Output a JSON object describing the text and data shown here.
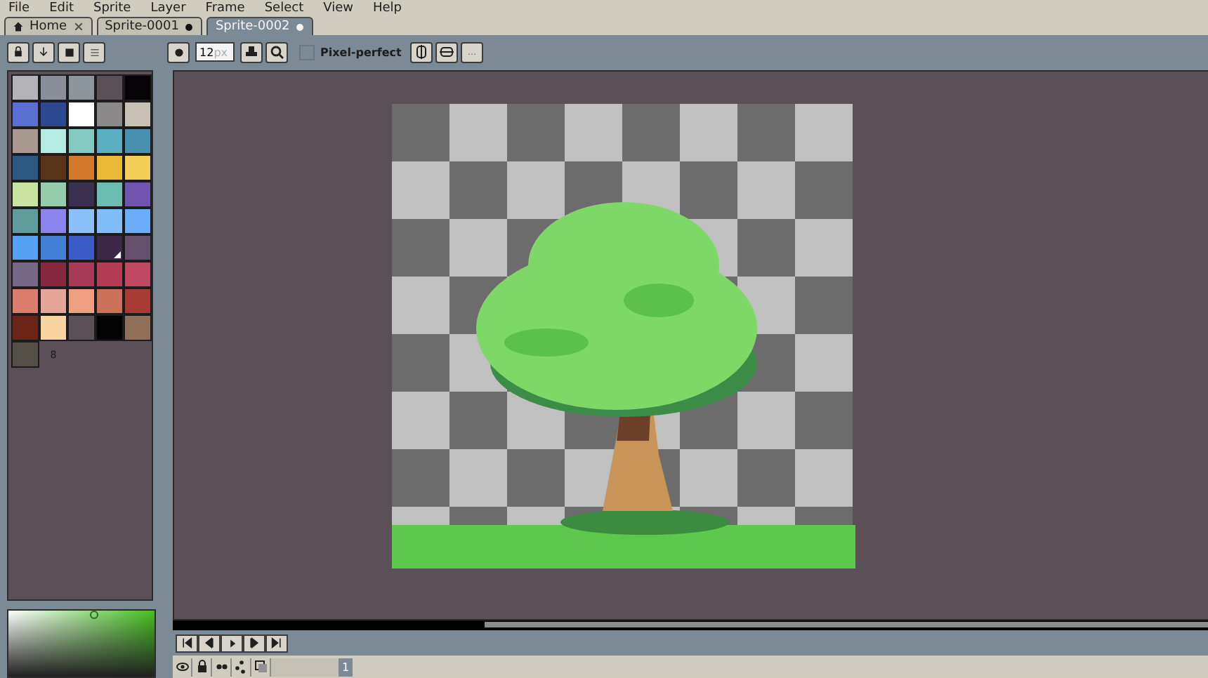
{
  "menu": [
    "File",
    "Edit",
    "Sprite",
    "Layer",
    "Frame",
    "Select",
    "View",
    "Help"
  ],
  "tabs": [
    {
      "label": "Home",
      "kind": "home",
      "selected": false
    },
    {
      "label": "Sprite-0001",
      "kind": "sprite",
      "selected": false
    },
    {
      "label": "Sprite-0002",
      "kind": "sprite",
      "selected": true
    }
  ],
  "toolbar": {
    "brush_size": "12",
    "brush_unit": "px",
    "pixel_perfect": {
      "label": "Pixel-perfect",
      "checked": false
    }
  },
  "palette": {
    "colors": [
      {
        "color": "#b4b4b8",
        "selected": false
      },
      {
        "color": "#8a8e98",
        "selected": false
      },
      {
        "color": "#8c949c",
        "selected": false
      },
      {
        "color": "#5c5058",
        "selected": false
      },
      {
        "color": "#060406",
        "selected": false
      },
      {
        "color": "#5a70d0",
        "selected": false
      },
      {
        "color": "#2c4890",
        "selected": false
      },
      {
        "color": "#ffffff",
        "selected": false
      },
      {
        "color": "#8a8888",
        "selected": false
      },
      {
        "color": "#c8c0b4",
        "selected": false
      },
      {
        "color": "#a89890",
        "selected": false
      },
      {
        "color": "#b4ece4",
        "selected": false
      },
      {
        "color": "#84cac0",
        "selected": false
      },
      {
        "color": "#5ab0c0",
        "selected": false
      },
      {
        "color": "#4a90b0",
        "selected": false
      },
      {
        "color": "#2c5884",
        "selected": false
      },
      {
        "color": "#5a3418",
        "selected": false
      },
      {
        "color": "#d4782c",
        "selected": false
      },
      {
        "color": "#ecb838",
        "selected": false
      },
      {
        "color": "#f4cc58",
        "selected": false
      },
      {
        "color": "#c8e4a0",
        "selected": false
      },
      {
        "color": "#94ccac",
        "selected": false
      },
      {
        "color": "#3c3050",
        "selected": false
      },
      {
        "color": "#6cbcb0",
        "selected": false
      },
      {
        "color": "#7054b0",
        "selected": false
      },
      {
        "color": "#609c9c",
        "selected": false
      },
      {
        "color": "#8a84ec",
        "selected": false
      },
      {
        "color": "#8cc0f8",
        "selected": false
      },
      {
        "color": "#80bcf8",
        "selected": false
      },
      {
        "color": "#6cacf8",
        "selected": false
      },
      {
        "color": "#54a0f4",
        "selected": false
      },
      {
        "color": "#4480d8",
        "selected": false
      },
      {
        "color": "#3c5cc8",
        "selected": false
      },
      {
        "color": "#3c2848",
        "selected": true
      },
      {
        "color": "#64506c",
        "selected": false
      },
      {
        "color": "#786888",
        "selected": false
      },
      {
        "color": "#882840",
        "selected": false
      },
      {
        "color": "#a83c58",
        "selected": false
      },
      {
        "color": "#b43c54",
        "selected": false
      },
      {
        "color": "#c04860",
        "selected": false
      },
      {
        "color": "#dc7c6c",
        "selected": false
      },
      {
        "color": "#e4a498",
        "selected": false
      },
      {
        "color": "#f0a080",
        "selected": false
      },
      {
        "color": "#cc7058",
        "selected": false
      },
      {
        "color": "#a83c34",
        "selected": false
      },
      {
        "color": "#6c2418",
        "selected": false
      },
      {
        "color": "#f8d4a0",
        "selected": false
      },
      {
        "color": "#5c5058",
        "selected": false
      },
      {
        "color": "#040404",
        "selected": false
      },
      {
        "color": "#907058",
        "selected": false
      },
      {
        "color": "#545048",
        "selected": false
      }
    ],
    "index_label": "8"
  },
  "frame": {
    "number": "1"
  }
}
